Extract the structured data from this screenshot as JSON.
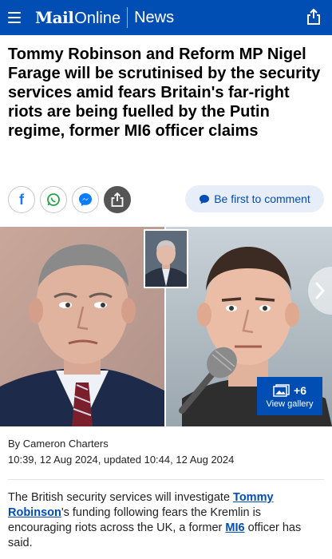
{
  "header": {
    "brand_mail": "Mail",
    "brand_online": "Online",
    "section": "News",
    "menu_icon": "hamburger-menu-icon",
    "share_icon": "share-icon",
    "color": "#004db3"
  },
  "headline": "Tommy Robinson and Reform MP Nigel Farage will be scrutinised by the security services amid fears Britain's far-right riots are being fuelled by the Putin regime, former MI6 officer claims",
  "social": {
    "facebook_label": "f",
    "icons": [
      "facebook-icon",
      "whatsapp-icon",
      "messenger-icon",
      "share-icon"
    ],
    "comment_label": "Be first to comment"
  },
  "gallery": {
    "count": "+6",
    "label": "View gallery"
  },
  "byline": "By Cameron Charters",
  "dateline": "10:39, 12 Aug 2024, updated 10:44, 12 Aug 2024",
  "intro": {
    "part1": "The British security services will investigate ",
    "link1": "Tommy Robinson",
    "part2": "'s funding following fears the Kremlin is encouraging riots across the UK, a former ",
    "link2": "MI6",
    "part3": " officer has said."
  }
}
